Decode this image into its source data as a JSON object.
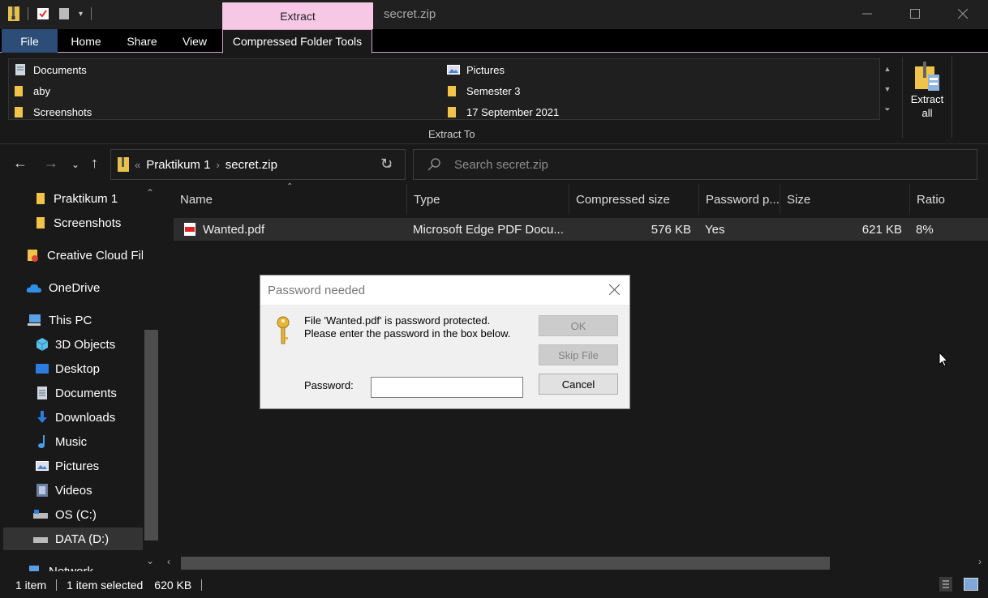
{
  "window": {
    "title": "secret.zip",
    "context_tab": "Extract"
  },
  "ribbon": {
    "tabs": [
      "File",
      "Home",
      "Share",
      "View",
      "Compressed Folder Tools"
    ],
    "extract_to": {
      "items": [
        "Documents",
        "aby",
        "Screenshots",
        "Pictures",
        "Semester 3",
        "17 September 2021"
      ],
      "label": "Extract To"
    },
    "extract_all": "Extract all",
    "help": "?"
  },
  "address": {
    "overflow": "«",
    "crumbs": [
      "Praktikum 1",
      "secret.zip"
    ],
    "search_placeholder": "Search secret.zip"
  },
  "sidebar": {
    "items": [
      {
        "label": "Praktikum 1",
        "icon": "folder-icon"
      },
      {
        "label": "Screenshots",
        "icon": "folder-icon"
      },
      {
        "label": "Creative Cloud Files",
        "icon": "creative-cloud-folder-icon"
      },
      {
        "label": "OneDrive",
        "icon": "onedrive-cloud-icon"
      },
      {
        "label": "This PC",
        "icon": "computer-icon"
      },
      {
        "label": "3D Objects",
        "icon": "3d-objects-icon"
      },
      {
        "label": "Desktop",
        "icon": "desktop-icon"
      },
      {
        "label": "Documents",
        "icon": "documents-icon"
      },
      {
        "label": "Downloads",
        "icon": "download-arrow-icon"
      },
      {
        "label": "Music",
        "icon": "music-note-icon"
      },
      {
        "label": "Pictures",
        "icon": "pictures-icon"
      },
      {
        "label": "Videos",
        "icon": "videos-icon"
      },
      {
        "label": "OS (C:)",
        "icon": "drive-icon"
      },
      {
        "label": "DATA (D:)",
        "icon": "drive-icon"
      },
      {
        "label": "Network",
        "icon": "network-icon"
      }
    ]
  },
  "columns": [
    "Name",
    "Type",
    "Compressed size",
    "Password p...",
    "Size",
    "Ratio"
  ],
  "files": [
    {
      "name": "Wanted.pdf",
      "type": "Microsoft Edge PDF Docu...",
      "compressed": "576 KB",
      "password": "Yes",
      "size": "621 KB",
      "ratio": "8%"
    }
  ],
  "status": {
    "count": "1 item",
    "selected": "1 item selected",
    "size": "620 KB"
  },
  "dialog": {
    "title": "Password needed",
    "message_line1": "File 'Wanted.pdf' is password protected.",
    "message_line2": "Please enter the password in the box below.",
    "password_label": "Password:",
    "password_value": "",
    "ok": "OK",
    "skip": "Skip File",
    "cancel": "Cancel"
  },
  "colors": {
    "accent_file_tab": "#2b4d77",
    "context_tab": "#f7c8e6",
    "background": "#191919"
  }
}
